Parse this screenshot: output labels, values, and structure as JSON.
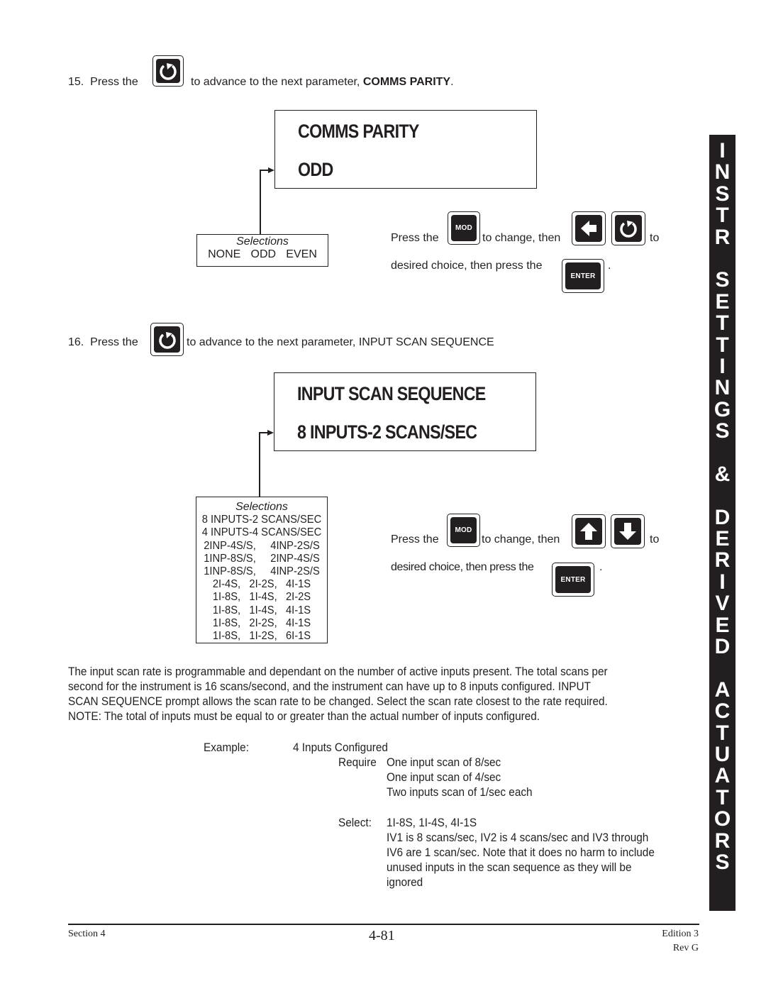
{
  "step15": {
    "number": "15.",
    "prefix": "Press  the",
    "suffix": "to advance to the next parameter, ",
    "param_bold": "COMMS PARITY",
    "end": ".",
    "key_icon": "cycle-advance-icon"
  },
  "display1": {
    "line1": "COMMS  PARITY",
    "line2": "ODD"
  },
  "selections1": {
    "title": "Selections",
    "options": [
      "NONE",
      "ODD",
      "EVEN"
    ]
  },
  "instructions1": {
    "press_the": "Press the",
    "mod_label": "MOD",
    "to_change_then": "to change, then",
    "to": "to",
    "desired_choice": "desired choice, then press the",
    "enter_label": "ENTER",
    "period": ".",
    "nav_icons": [
      "left-arrow-icon",
      "cycle-advance-icon"
    ]
  },
  "step16": {
    "number": "16.",
    "prefix": "Press the",
    "suffix": "to advance to the next parameter, INPUT SCAN SEQUENCE",
    "key_icon": "cycle-advance-icon"
  },
  "display2": {
    "line1": "INPUT SCAN SEQUENCE",
    "line2": "8 INPUTS-2 SCANS/SEC"
  },
  "selections2": {
    "title": "Selections",
    "options": [
      "8 INPUTS-2 SCANS/SEC",
      "4 INPUTS-4 SCANS/SEC",
      "2INP-4S/S,     4INP-2S/S",
      "1INP-8S/S,     2INP-4S/S",
      "1INP-8S/S,     4INP-2S/S",
      "2I-4S,   2I-2S,   4I-1S",
      "1I-8S,   1I-4S,   2I-2S",
      "1I-8S,   1I-4S,   4I-1S",
      "1I-8S,   2I-2S,   4I-1S",
      "1I-8S,   1I-2S,   6I-1S"
    ]
  },
  "instructions2": {
    "press_the": "Press the",
    "mod_label": "MOD",
    "to_change_then": "to change, then",
    "to": "to",
    "desired_choice": "desired choice, then press the",
    "enter_label": "ENTER",
    "period": ".",
    "nav_icons": [
      "up-arrow-icon",
      "down-arrow-icon"
    ]
  },
  "body_paragraph": [
    "The input scan rate is programmable and dependant on the number of active inputs present.  The total scans per",
    "second for the instrument is 16 scans/second, and the instrument can have up to 8 inputs configured.  INPUT",
    "SCAN SEQUENCE prompt allows the scan rate to be changed.  Select the scan rate  closest to the rate required.",
    "NOTE: The total of inputs must be equal to or greater than the actual number of inputs configured."
  ],
  "example": {
    "label": "Example:",
    "configured": "4 Inputs Configured",
    "require_label": "Require",
    "require_lines": [
      "One input scan of 8/sec",
      "One input scan of 4/sec",
      "Two inputs scan of 1/sec each"
    ],
    "select_label": "Select:",
    "select_value": "1I-8S,  1I-4S,  4I-1S",
    "explanation_lines": [
      "IV1 is 8 scans/sec, IV2 is 4 scans/sec and IV3 through",
      "IV6 are 1 scan/sec.  Note that it does no harm to include",
      "unused inputs in the scan sequence as they will be",
      "ignored"
    ]
  },
  "side_tab": {
    "letters": [
      "I",
      "N",
      "S",
      "T",
      "R",
      "",
      "S",
      "E",
      "T",
      "T",
      "I",
      "N",
      "G",
      "S",
      "",
      "&",
      "",
      "D",
      "E",
      "R",
      "I",
      "V",
      "E",
      "D",
      "",
      "A",
      "C",
      "T",
      "U",
      "A",
      "T",
      "O",
      "R",
      "S"
    ],
    "text": "INSTR SETTINGS & DERIVED ACTUATORS"
  },
  "footer": {
    "section": "Section 4",
    "page": "4-81",
    "edition": "Edition 3",
    "revision": "Rev G"
  }
}
